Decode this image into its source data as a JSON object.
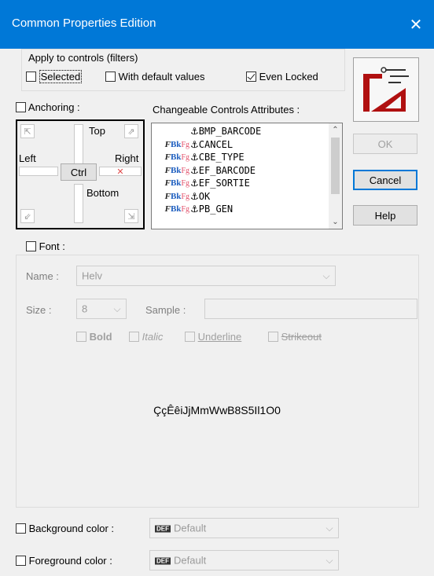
{
  "window": {
    "title": "Common Properties Edition",
    "close_glyph": "✕"
  },
  "filters": {
    "label": "Apply to controls  (filters)",
    "selected": {
      "label": "Selected",
      "checked": false
    },
    "with_default_values": {
      "label": "With default values",
      "checked": false
    },
    "even_locked": {
      "label": "Even Locked",
      "checked": true
    }
  },
  "anchoring": {
    "label": "Anchoring :",
    "checked": false,
    "top_label": "Top",
    "left_label": "Left",
    "right_label": "Right",
    "bottom_label": "Bottom",
    "ctrl_label": "Ctrl"
  },
  "attributes": {
    "label": "Changeable Controls Attributes :",
    "items": [
      {
        "prefix_f": "",
        "prefix_bk": "",
        "prefix_fg": "",
        "anchor": "⚓",
        "name": "BMP_BARCODE"
      },
      {
        "prefix_f": "F",
        "prefix_bk": "Bk",
        "prefix_fg": "Fg",
        "anchor": "⚓",
        "name": "CANCEL"
      },
      {
        "prefix_f": "F",
        "prefix_bk": "Bk",
        "prefix_fg": "Fg",
        "anchor": "⚓",
        "name": "CBE_TYPE"
      },
      {
        "prefix_f": "F",
        "prefix_bk": "Bk",
        "prefix_fg": "Fg",
        "anchor": "⚓",
        "name": "EF_BARCODE"
      },
      {
        "prefix_f": "F",
        "prefix_bk": "Bk",
        "prefix_fg": "Fg",
        "anchor": "⚓",
        "name": "EF_SORTIE"
      },
      {
        "prefix_f": "F",
        "prefix_bk": "Bk",
        "prefix_fg": "Fg",
        "anchor": "⚓",
        "name": "OK"
      },
      {
        "prefix_f": "F",
        "prefix_bk": "Bk",
        "prefix_fg": "Fg",
        "anchor": "⚓",
        "name": "PB_GEN"
      }
    ]
  },
  "buttons": {
    "ok": "OK",
    "cancel": "Cancel",
    "help": "Help"
  },
  "font": {
    "label": "Font :",
    "checked": false,
    "name_label": "Name :",
    "name_value": "Helv",
    "size_label": "Size :",
    "size_value": "8",
    "sample_label": "Sample :",
    "sample_value": "",
    "bold": "Bold",
    "italic": "Italic",
    "underline": "Underline",
    "strikeout": "Strikeout",
    "preview_text": "ÇçÊêiJjMmWwB8S5Il1O0"
  },
  "background": {
    "label": "Background color :",
    "checked": false,
    "badge": "DEF",
    "value": "Default"
  },
  "foreground": {
    "label": "Foreground color :",
    "checked": false,
    "badge": "DEF",
    "value": "Default"
  },
  "colors": {
    "titlebar": "#0078d7",
    "accent_red": "#b01010",
    "bk_blue": "#1f5fbf",
    "fg_pink": "#e2506a"
  }
}
